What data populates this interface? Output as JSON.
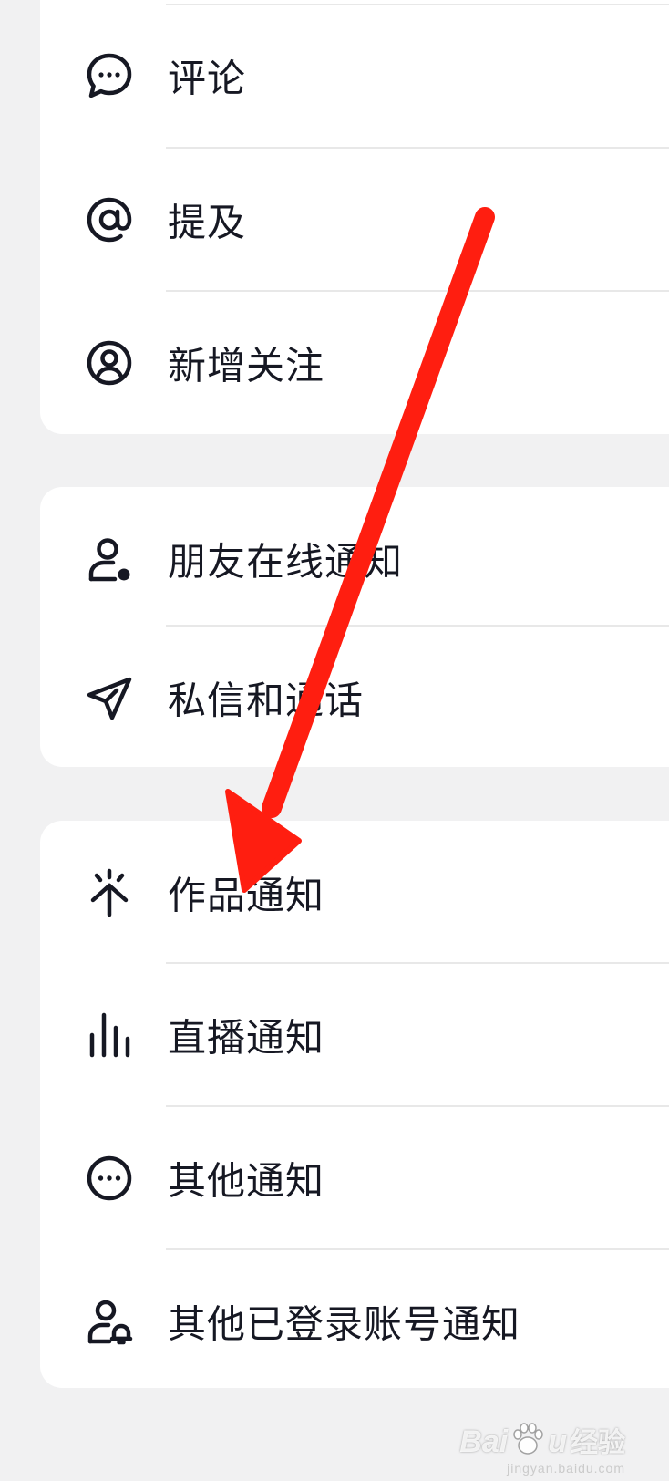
{
  "group1": {
    "items": [
      {
        "label": "评论",
        "icon": "comment-bubble-icon"
      },
      {
        "label": "提及",
        "icon": "at-sign-icon"
      },
      {
        "label": "新增关注",
        "icon": "user-circle-icon"
      }
    ]
  },
  "group2": {
    "items": [
      {
        "label": "朋友在线通知",
        "icon": "user-online-icon"
      },
      {
        "label": "私信和通话",
        "icon": "paper-plane-icon"
      }
    ]
  },
  "group3": {
    "items": [
      {
        "label": "作品通知",
        "icon": "sparkle-arrow-icon"
      },
      {
        "label": "直播通知",
        "icon": "live-bars-icon"
      },
      {
        "label": "其他通知",
        "icon": "more-circle-icon"
      },
      {
        "label": "其他已登录账号通知",
        "icon": "user-bell-icon"
      }
    ]
  },
  "annotation": {
    "arrow_color": "#ff1e10"
  },
  "watermark": {
    "brand": "Bai",
    "brand2": "u",
    "cn": "经验",
    "url": "jingyan.baidu.com"
  }
}
